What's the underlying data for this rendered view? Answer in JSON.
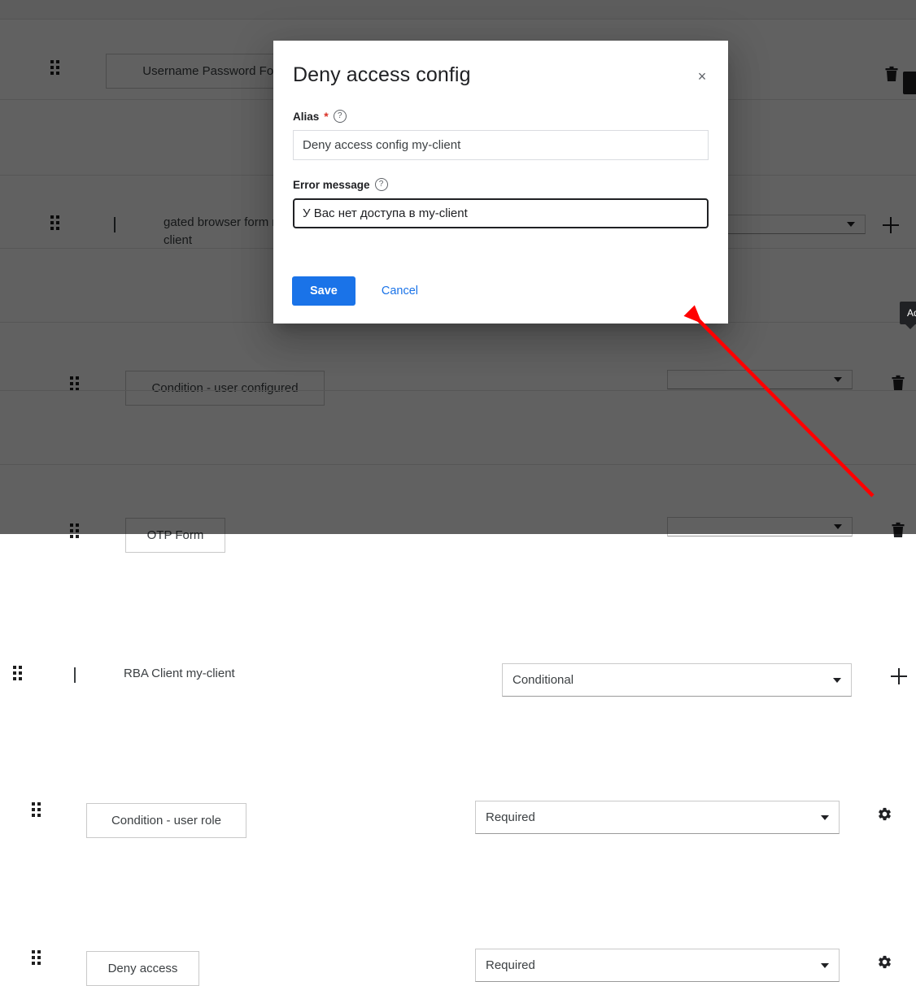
{
  "app": {
    "background_color": "#ffffff",
    "overlay_color": "#606060",
    "accent_color": "#1a73e8",
    "annotation_color": "#ff0000"
  },
  "flow_table": {
    "rows": [
      {
        "name": "Username Password Form",
        "style": "boxed",
        "indent": "level2",
        "handle": "drag-handle-icon",
        "caret": false,
        "requirement": "",
        "has_requirement": false,
        "action": "trash-icon"
      },
      {
        "name": "gated browser form my-client",
        "style": "plain",
        "indent": "level1",
        "handle": "drag-handle-icon",
        "caret": true,
        "requirement": "",
        "has_requirement": true,
        "action": "plus-icon"
      },
      {
        "name": "Condition - user configured",
        "style": "boxed",
        "indent": "level3",
        "handle": "drag-handle-icon",
        "caret": false,
        "requirement": "",
        "has_requirement": true,
        "action": "trash-icon"
      },
      {
        "name": "OTP Form",
        "style": "boxed",
        "indent": "level3",
        "handle": "drag-handle-icon",
        "caret": false,
        "requirement": "",
        "has_requirement": true,
        "action": "trash-icon"
      },
      {
        "name": "RBA Client my-client",
        "style": "plain",
        "indent": "level0",
        "handle": "drag-handle-icon",
        "caret": true,
        "requirement": "Conditional",
        "has_requirement": true,
        "action": "plus-icon"
      },
      {
        "name": "Condition - user role",
        "style": "boxed",
        "indent": "level2",
        "handle": "drag-handle-icon",
        "caret": false,
        "requirement": "Required",
        "has_requirement": true,
        "action": "gear-icon"
      },
      {
        "name": "Deny access",
        "style": "boxed",
        "indent": "level2",
        "handle": "drag-handle-icon",
        "caret": false,
        "requirement": "Required",
        "has_requirement": true,
        "action": "gear-icon"
      }
    ],
    "tooltip": "Ad"
  },
  "dialog": {
    "title": "Deny access config",
    "close_label": "×",
    "alias": {
      "label": "Alias",
      "required_marker": "*",
      "help_icon": "help-circle-icon",
      "value": "Deny access config my-client",
      "placeholder": ""
    },
    "error_message": {
      "label": "Error message",
      "help_icon": "help-circle-icon",
      "value": "У Вас нет доступа в my-client",
      "placeholder": ""
    },
    "save_label": "Save",
    "cancel_label": "Cancel"
  }
}
